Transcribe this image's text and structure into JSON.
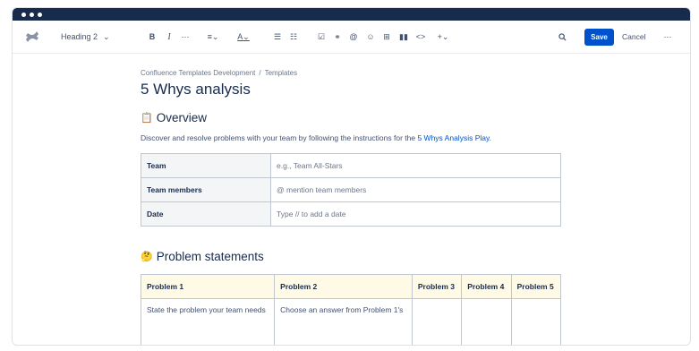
{
  "toolbar": {
    "heading_style": "Heading 2",
    "save_label": "Save",
    "cancel_label": "Cancel"
  },
  "breadcrumb": {
    "space": "Confluence Templates Development",
    "separator": "/",
    "parent": "Templates"
  },
  "page": {
    "title": "5 Whys analysis"
  },
  "overview": {
    "emoji": "📋",
    "heading": "Overview",
    "description_prefix": "Discover and resolve problems with your team by following the instructions for the ",
    "description_link": "5 Whys Analysis Play",
    "description_suffix": "."
  },
  "info_table": {
    "rows": [
      {
        "key": "Team",
        "value": "e.g., Team All-Stars"
      },
      {
        "key": "Team members",
        "value": "@ mention team members"
      },
      {
        "key": "Date",
        "value": "Type // to add a date"
      }
    ]
  },
  "problems": {
    "emoji": "🤔",
    "heading": "Problem statements",
    "columns": [
      "Problem 1",
      "Problem 2",
      "Problem 3",
      "Problem 4",
      "Problem 5"
    ],
    "row": [
      "State the problem your team needs",
      "Choose an answer from Problem 1's",
      "",
      "",
      ""
    ]
  }
}
